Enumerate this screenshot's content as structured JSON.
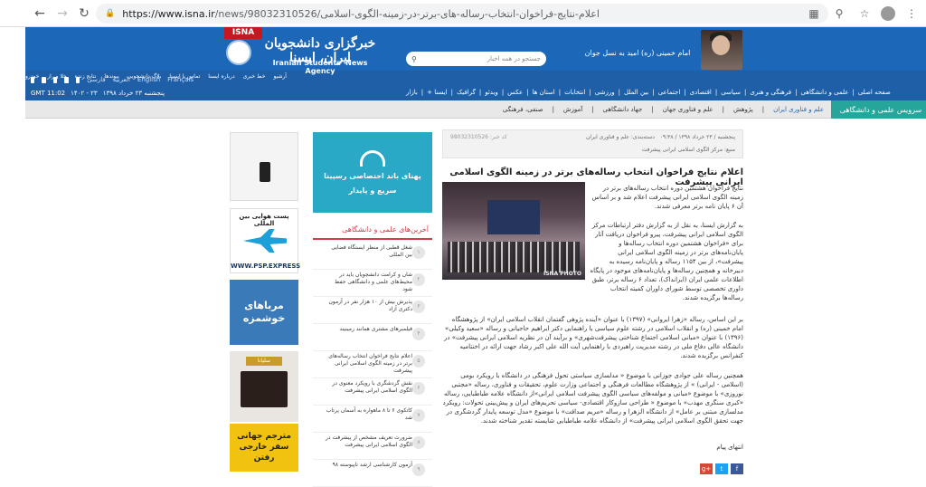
{
  "browser": {
    "url_host": "https://www.isna.ir",
    "url_path": "/news/98032310526/اعلام-نتایج-فراخوان-انتخاب-رساله-های-برتر-در-زمینه-الگوی-اسلامی"
  },
  "header": {
    "tag": "ISNA",
    "brand_fa": "خبرگزاری دانشجویان ایران، ایسنا",
    "brand_en": "Iranian Students' News Agency",
    "search_placeholder": "جستجو در همه اخبار",
    "leader_quote": "امام خمینی (ره) امید به نسل جوان",
    "topnav": [
      "آرشیو",
      "خط خبری",
      "درباره ایسنا",
      "تماس با ایسنا",
      "بلاگ دانشجویی",
      "پیوندها",
      "نتایج زنده",
      "خلا و راز",
      "خودرو"
    ],
    "languages": [
      "فارسی",
      "العربية",
      "English",
      "Français"
    ],
    "date": "پنجشنبه ۲۳ خرداد ۱۳۹۸",
    "date2": "۱۴۰۲ - ۲۳",
    "time": "GMT 11:02",
    "sections": [
      "صفحه اصلی",
      "علمی و دانشگاهی",
      "فرهنگی و هنری",
      "سیاسی",
      "اقتصادی",
      "اجتماعی",
      "بین الملل",
      "ورزشی",
      "انتخابات",
      "استان ها",
      "عکس",
      "ویدئو",
      "گرافیک",
      "ایسنا +",
      "بازار"
    ]
  },
  "subnav": {
    "active": "سرویس علمی و دانشگاهی",
    "items": [
      "علم و فناوری ایران",
      "پژوهش",
      "علم و فناوری جهان",
      "جهاد دانشگاهی",
      "آموزش",
      "صنفی، فرهنگی"
    ]
  },
  "ads": {
    "psp_title": "پست هوایی بین المللی",
    "psp_url": "WWW.PSP.EXPRESS",
    "morabba": "مرباهای خوشمزه",
    "piano_badge": "سلیانا",
    "yellow": "مترجم جهانی سفر خارجی رفتن"
  },
  "mid_ad": {
    "line1": "پهنای باند اختصاصی رسپینا",
    "line2": "سریع و پایدار"
  },
  "latest": {
    "heading": "آخرین‌های علمی و دانشگاهی",
    "items": [
      {
        "n": "۱",
        "text": "شغل قطبی از منظر ایستگاه فضایی بین المللی"
      },
      {
        "n": "۲",
        "text": "شان و کرامت دانشجویان باید در محیط‌های علمی و دانشگاهی حفظ شود"
      },
      {
        "n": "۳",
        "text": "پذیرش بیش از ۱۰ هزار نفر در آزمون دکتری آزاد"
      },
      {
        "n": "۴",
        "text": "فیلمبرهای مشتری همانند زمینیند"
      },
      {
        "n": "۵",
        "text": "اعلام نتایج فراخوان انتخاب رساله‌های برتر در زمینه الگوی اسلامی ایرانی پیشرفت"
      },
      {
        "n": "۶",
        "text": "نقش گردشگری با رویکرد معنوی در الگوی اسلامی ایرانی پیشرفت"
      },
      {
        "n": "۷",
        "text": "کاتکوی ۶ تا ۸ ماهواره به آسمان پرتاب شد"
      },
      {
        "n": "۸",
        "text": "ضرورت تعریف مشخص از پیشرفت در الگوی اسلامی ایرانی پیشرفت"
      },
      {
        "n": "۹",
        "text": "آزمون کارشناسی ارشد ناپیوسته ۹۸"
      }
    ]
  },
  "article": {
    "meta_date": "پنجشنبه / ۲۳ خرداد ۱۳۹۸ / ۰۹:۳۸",
    "meta_cat": "دسته‌بندی: علم و فناوری ایران",
    "meta_code": "کد خبر: 98032310526",
    "meta_source": "منبع: مرکز الگوی اسلامی ایرانی پیشرفت",
    "title": "اعلام نتایج فراخوان انتخاب رساله‌های برتر در زمینه الگوی اسلامی ایرانی پیشرفت",
    "lead": "نتایج فراخوان هشتمین دوره انتخاب رساله‌های برتر در زمینه الگوی اسلامی ایرانی پیشرفت اعلام شد و بر اساس آن ۶ پایان نامه برتر معرفی شدند.",
    "photo_watermark": "ISNA PHOTO",
    "para1": "به گزارش ایسنا، به نقل از به گزارش دفتر ارتباطات مرکز الگوی اسلامی ایرانی پیشرفت، پیرو فراخوان دریافت آثار برای «فراخوان هشتمین دوره انتخاب رساله‌ها و پایان‌نامه‌های برتر در زمینه الگوی اسلامی ایرانی پیشرفت»، از بین ۱۱۵۴ رساله و پایان‌نامه رسیده به دبیرخانه و همچنین رساله‌ها و پایان‌نامه‌های موجود در پایگاه اطلاعات علمی ایران (ایرانداک)، تعداد ۶ رساله برتر، طبق داوری تخصصی توسط شورای داوران کمیته انتخاب رساله‌ها برگزیده شدند.",
    "para2": "بر این اساس، رساله «زهرا ایروانی» (۱۳۹۷) با عنوان «آینده پژوهی گفتمان انقلاب اسلامی ایران» از پژوهشگاه امام خمینی (ره) و انقلاب اسلامی در رشته علوم سیاسی با راهنمایی دکتر ابراهیم حاجیانی و رساله «سعید وکیلی» (۱۳۹۶) با عنوان «مبانی اسلامی اجتماع شناختی پیشرفت‌شهری» و برآیند آن در نظریه اسلامی ایرانی پیشرفت» در دانشگاه عالی دفاع ملی در رشته مدیریت راهبردی با راهنمایی آیت الله علی اکبر رشاد جهت ارائه در اختتامیه کنفرانس برگزیده شدند.",
    "para3": "همچنین رساله علی جوادی جوزانی با موضوع « مدلسازی سیاستی تحول فرهنگی در دانشگاه با رویکرد بومی (اسلامی - ایرانی) » از پژوهشگاه مطالعات فرهنگی و اجتماعی وزارت علوم، تحقیقات و فناوری، رساله «مجتبی نوروزی» با موضوع «مبانی و مولفه‌های سیاسی الگوی پیشرفت اسلامی ایرانی»از دانشگاه علامه طباطبایی، رساله «کبری سنگری مهذب» با موضوع « طراحی سازوکار اقتصادی- سیاسی تحریم‌های ایران و پیش‌بینی تحولات: رویکرد مدلسازی مبتنی بر عامل» از دانشگاه الزهرا و رساله «مریم صداقت» با موضوع «مدل توسعه پایدار گردشگری در جهت تحقق الگوی اسلامی ایرانی پیشرفت» از دانشگاه علامه طباطبایی شایسته تقدیر شناخته شدند.",
    "endnote": "انتهای پیام"
  }
}
